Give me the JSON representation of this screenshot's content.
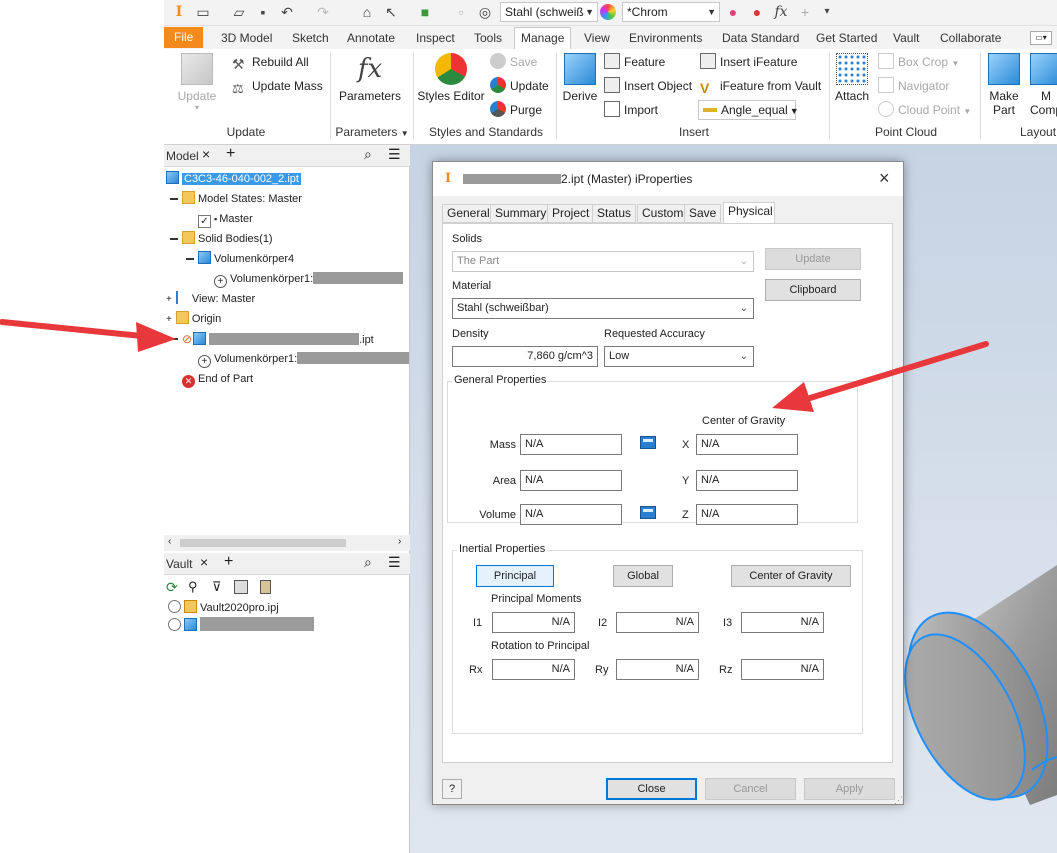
{
  "qat": {
    "material_combo": "Stahl (schweiß",
    "appearance_combo": "*Chrom"
  },
  "tabs": [
    "File",
    "3D Model",
    "Sketch",
    "Annotate",
    "Inspect",
    "Tools",
    "Manage",
    "View",
    "Environments",
    "Data Standard",
    "Get Started",
    "Vault",
    "Collaborate"
  ],
  "ribbon": {
    "update": {
      "label": "Update",
      "group": "Update",
      "rebuild_all": "Rebuild All",
      "update_mass": "Update Mass"
    },
    "parameters": {
      "label": "Parameters",
      "group": "Parameters"
    },
    "styles": {
      "editor": "Styles Editor",
      "save": "Save",
      "update": "Update",
      "purge": "Purge",
      "group": "Styles and Standards"
    },
    "insert": {
      "derive": "Derive",
      "feature": "Feature",
      "insert_object": "Insert Object",
      "import": "Import",
      "insert_ifeature": "Insert iFeature",
      "ifeature_from_vault": "iFeature from Vault",
      "angle_combo": "Angle_equal",
      "group": "Insert"
    },
    "point_cloud": {
      "attach": "Attach",
      "box_crop": "Box Crop",
      "navigator": "Navigator",
      "cloud_point": "Cloud Point",
      "group": "Point Cloud"
    },
    "layout": {
      "make_part": "Make Part",
      "make_part_line1": "Make",
      "make_part_line2": "Part",
      "make_comp_line1": "M",
      "make_comp_line2": "Comp",
      "group": "Layout"
    }
  },
  "browser": {
    "title": "Model",
    "root": "C3C3-46-040-002_2.ipt",
    "items": {
      "model_states": "Model States: Master",
      "master": "Master",
      "solid_bodies": "Solid Bodies(1)",
      "volumenkoerper4": "Volumenkörper4",
      "volumenkoerper1_a": "Volumenkörper1:",
      "view_master": "View: Master",
      "origin": "Origin",
      "derived_part_suffix": ".ipt",
      "volumenkoerper1_b": "Volumenkörper1:",
      "end_of_part": "End of Part"
    }
  },
  "vault": {
    "title": "Vault",
    "project": "Vault2020pro.ipj"
  },
  "dialog": {
    "title_suffix": "2.ipt (Master) iProperties",
    "tabs": [
      "General",
      "Summary",
      "Project",
      "Status",
      "Custom",
      "Save",
      "Physical"
    ],
    "solids_label": "Solids",
    "solids_value": "The Part",
    "material_label": "Material",
    "material_value": "Stahl (schweißbar)",
    "density_label": "Density",
    "density_value": "7,860 g/cm^3",
    "accuracy_label": "Requested Accuracy",
    "accuracy_value": "Low",
    "update_button": "Update",
    "clipboard_button": "Clipboard",
    "general_properties": "General Properties",
    "center_of_gravity": "Center of Gravity",
    "mass_label": "Mass",
    "mass_value": "N/A",
    "area_label": "Area",
    "area_value": "N/A",
    "volume_label": "Volume",
    "volume_value": "N/A",
    "x_label": "X",
    "x_value": "N/A",
    "y_label": "Y",
    "y_value": "N/A",
    "z_label": "Z",
    "z_value": "N/A",
    "inertial_properties": "Inertial Properties",
    "principal_button": "Principal",
    "global_button": "Global",
    "cog_button": "Center of Gravity",
    "principal_moments": "Principal Moments",
    "i1_label": "I1",
    "i1_value": "N/A",
    "i2_label": "I2",
    "i2_value": "N/A",
    "i3_label": "I3",
    "i3_value": "N/A",
    "rotation_to_principal": "Rotation to Principal",
    "rx_label": "Rx",
    "rx_value": "N/A",
    "ry_label": "Ry",
    "ry_value": "N/A",
    "rz_label": "Rz",
    "rz_value": "N/A",
    "close_button": "Close",
    "cancel_button": "Cancel",
    "apply_button": "Apply",
    "help_button": "?"
  },
  "colors": {
    "file_tab": "#f48a1b",
    "arrow_red": "#e8383b",
    "selection_blue": "#3a9ae8",
    "model_edge": "#1e90ff"
  }
}
